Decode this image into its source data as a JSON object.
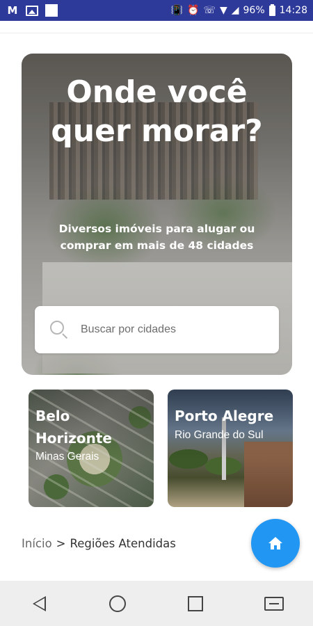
{
  "status_bar": {
    "icons_left": [
      "gmail-icon",
      "photo-icon",
      "square-icon"
    ],
    "icons_right": [
      "vibrate-icon",
      "alarm-icon",
      "wifi-call-icon",
      "wifi-icon",
      "signal-icon",
      "battery-icon"
    ],
    "battery": "96%",
    "time": "14:28",
    "color": "#2e3a9a"
  },
  "hero": {
    "title": "Onde você quer morar?",
    "subtitle": "Diversos imóveis para alugar ou comprar em mais de 48 cidades"
  },
  "search": {
    "placeholder": "Buscar por cidades"
  },
  "cities": [
    {
      "name": "Belo Horizonte",
      "state": "Minas Gerais"
    },
    {
      "name": "Porto Alegre",
      "state": "Rio Grande do Sul"
    }
  ],
  "breadcrumb": {
    "home": "Início",
    "separator": ">",
    "current": "Regiões Atendidas"
  },
  "fab": {
    "icon": "home-icon",
    "color": "#2196f3"
  },
  "nav_bar": {
    "buttons": [
      "back-icon",
      "home-circle-icon",
      "recents-icon",
      "switch-app-icon"
    ]
  }
}
